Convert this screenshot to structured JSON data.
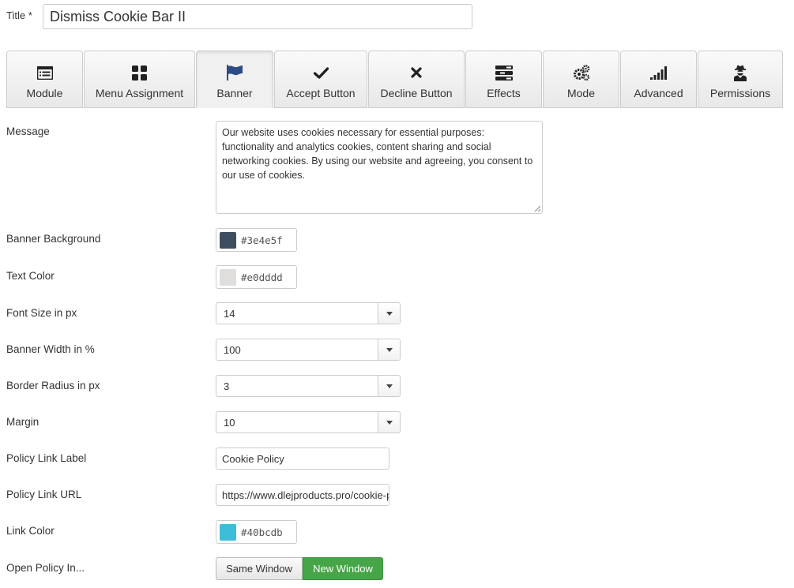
{
  "title": {
    "label": "Title *",
    "value": "Dismiss Cookie Bar II"
  },
  "tabs": [
    {
      "label": "Module",
      "icon": "list-icon"
    },
    {
      "label": "Menu Assignment",
      "icon": "grid-icon"
    },
    {
      "label": "Banner",
      "icon": "flag-icon",
      "active": true
    },
    {
      "label": "Accept Button",
      "icon": "check-icon"
    },
    {
      "label": "Decline Button",
      "icon": "x-icon"
    },
    {
      "label": "Effects",
      "icon": "bars-icon"
    },
    {
      "label": "Mode",
      "icon": "gears-icon"
    },
    {
      "label": "Advanced",
      "icon": "signal-icon"
    },
    {
      "label": "Permissions",
      "icon": "agent-icon"
    }
  ],
  "fields": {
    "message": {
      "label": "Message",
      "value": "Our website uses cookies necessary for essential purposes: functionality and analytics cookies, content sharing and social networking cookies.  By using our website and agreeing, you consent to our use of cookies."
    },
    "banner_background": {
      "label": "Banner Background",
      "value": "#3e4e5f",
      "swatch": "#3e4e5f"
    },
    "text_color": {
      "label": "Text Color",
      "value": "#e0dddd",
      "swatch": "#e0dddd"
    },
    "font_size": {
      "label": "Font Size in px",
      "value": "14"
    },
    "banner_width": {
      "label": "Banner Width in %",
      "value": "100"
    },
    "border_radius": {
      "label": "Border Radius in px",
      "value": "3"
    },
    "margin": {
      "label": "Margin",
      "value": "10"
    },
    "policy_link_label": {
      "label": "Policy Link Label",
      "value": "Cookie Policy"
    },
    "policy_link_url": {
      "label": "Policy Link URL",
      "value": "https://www.dlejproducts.pro/cookie-policy"
    },
    "link_color": {
      "label": "Link Color",
      "value": "#40bcdb",
      "swatch": "#40bcdb"
    },
    "open_policy_in": {
      "label": "Open Policy In...",
      "options": [
        "Same Window",
        "New Window"
      ],
      "selected": "New Window"
    }
  },
  "colors": {
    "active_toggle": "#46a546",
    "icon": "#222222",
    "flag_icon": "#2d4a86"
  }
}
